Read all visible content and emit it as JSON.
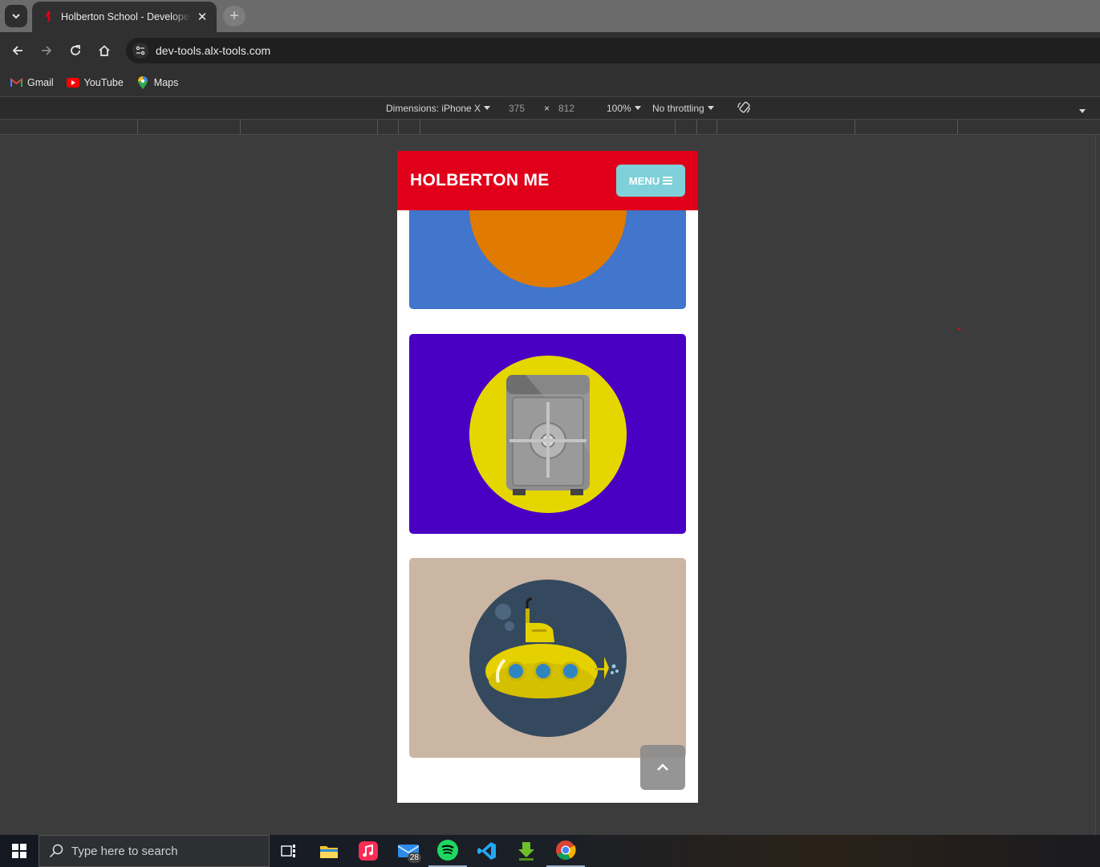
{
  "browser": {
    "tab": {
      "title": "Holberton School - Developer t",
      "close_glyph": "✕"
    },
    "new_tab_glyph": "+",
    "address": "dev-tools.alx-tools.com",
    "bookmarks": [
      {
        "label": "Gmail",
        "icon": "gmail-icon"
      },
      {
        "label": "YouTube",
        "icon": "youtube-icon"
      },
      {
        "label": "Maps",
        "icon": "maps-icon"
      }
    ]
  },
  "device_toolbar": {
    "dimensions_label": "Dimensions: iPhone X",
    "width": "375",
    "times": "×",
    "height": "812",
    "zoom": "100%",
    "throttling": "No throttling"
  },
  "site": {
    "title": "HOLBERTON ME",
    "menu_label": "MENU",
    "cards": [
      {
        "name": "game-controller-card",
        "background": "#4275cc",
        "circle": "#e07a00",
        "icon": "game-controller-icon"
      },
      {
        "name": "safe-card",
        "background": "#4a00c2",
        "circle": "#e6d600",
        "icon": "safe-icon"
      },
      {
        "name": "submarine-card",
        "background": "#cbb5a3",
        "circle": "#34495e",
        "icon": "submarine-icon"
      }
    ]
  },
  "taskbar": {
    "search_placeholder": "Type here to search",
    "mail_badge": "28"
  },
  "colors": {
    "header_red": "#e0001a",
    "menu_teal": "#7fd0d8"
  }
}
